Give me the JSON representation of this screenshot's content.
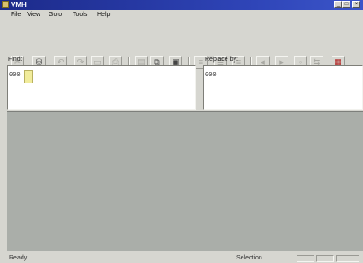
{
  "window": {
    "title": "VMH"
  },
  "menu": {
    "items": [
      "File",
      "View",
      "Goto",
      "Tools",
      "Help"
    ]
  },
  "toolbar": {
    "buttons": [
      {
        "name": "cut-icon",
        "glyph": "✂"
      },
      {
        "name": "open-icon",
        "glyph": "⛁"
      },
      {
        "name": "undo-icon",
        "glyph": "↶"
      },
      {
        "name": "redo-icon",
        "glyph": "↷"
      },
      {
        "name": "save-icon",
        "glyph": "▭"
      },
      {
        "name": "print-icon",
        "glyph": "⎙"
      },
      {
        "name": "paste-icon",
        "glyph": "▤"
      },
      {
        "name": "copy-icon",
        "glyph": "⧉"
      },
      {
        "name": "disk-icon",
        "glyph": "▣"
      },
      {
        "name": "align-left-icon",
        "glyph": "≡"
      },
      {
        "name": "align-center-icon",
        "glyph": "≣"
      },
      {
        "name": "align-right-icon",
        "glyph": "≡"
      },
      {
        "name": "previous-icon",
        "glyph": "◂"
      },
      {
        "name": "next-icon",
        "glyph": "▸"
      },
      {
        "name": "mark-icon",
        "glyph": "◦"
      },
      {
        "name": "replace-icon",
        "glyph": "⇆"
      },
      {
        "name": "settings-icon",
        "glyph": "▦"
      }
    ]
  },
  "find": {
    "label": "Find:",
    "value": "000"
  },
  "replace": {
    "label": "Replace by:",
    "value": "000"
  },
  "status": {
    "left": "Ready",
    "middle": "Selection"
  }
}
